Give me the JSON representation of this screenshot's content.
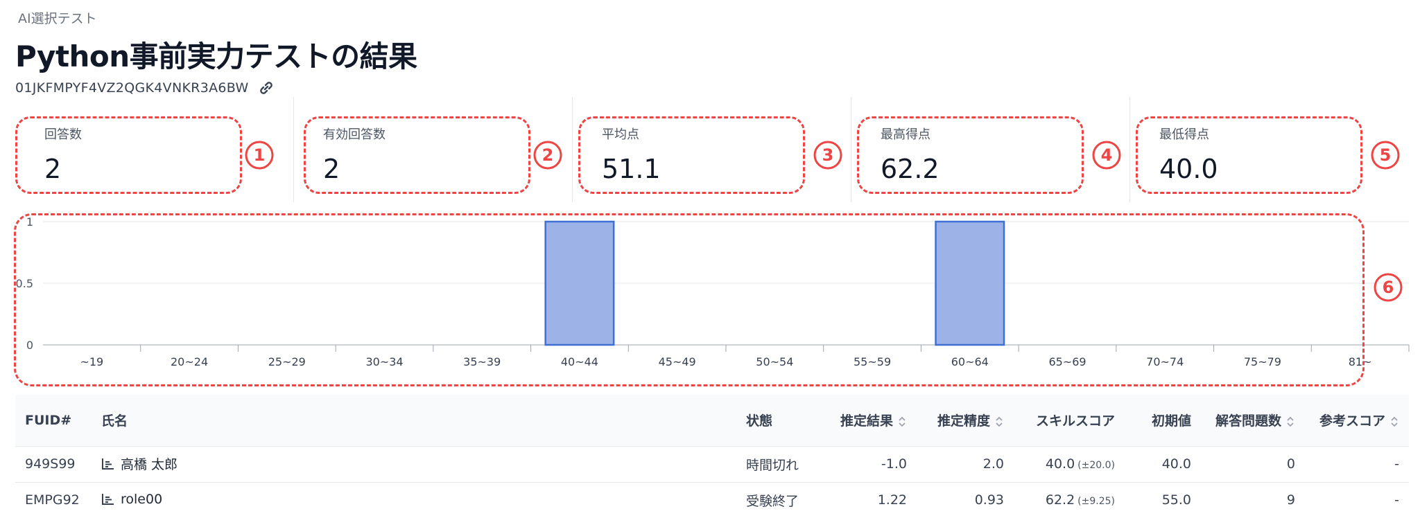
{
  "breadcrumb": "AI選択テスト",
  "title": "Python事前実力テストの結果",
  "test_id": "01JKFMPYF4VZ2QGK4VNKR3A6BW",
  "stats": [
    {
      "label": "回答数",
      "value": "2",
      "badge": "①"
    },
    {
      "label": "有効回答数",
      "value": "2",
      "badge": "②"
    },
    {
      "label": "平均点",
      "value": "51.1",
      "badge": "③"
    },
    {
      "label": "最高得点",
      "value": "62.2",
      "badge": "④"
    },
    {
      "label": "最低得点",
      "value": "40.0",
      "badge": "⑤"
    }
  ],
  "chart_badge": "⑥",
  "chart_data": {
    "type": "bar",
    "categories": [
      "~19",
      "20~24",
      "25~29",
      "30~34",
      "35~39",
      "40~44",
      "45~49",
      "50~54",
      "55~59",
      "60~64",
      "65~69",
      "70~74",
      "75~79",
      "81~"
    ],
    "values": [
      0,
      0,
      0,
      0,
      0,
      1,
      0,
      0,
      0,
      1,
      0,
      0,
      0,
      0
    ],
    "yticks": [
      "0",
      "0.5",
      "1"
    ],
    "ylim": [
      0,
      1
    ],
    "grid": true,
    "bar_color": "#9db3e8",
    "bar_stroke": "#3f6fd1"
  },
  "table": {
    "headers": [
      {
        "label": "FUID#",
        "sortable": false
      },
      {
        "label": "氏名",
        "sortable": false
      },
      {
        "label": "状態",
        "sortable": false
      },
      {
        "label": "推定結果",
        "sortable": true
      },
      {
        "label": "推定精度",
        "sortable": true
      },
      {
        "label": "スキルスコア",
        "sortable": false
      },
      {
        "label": "初期値",
        "sortable": false
      },
      {
        "label": "解答問題数",
        "sortable": true
      },
      {
        "label": "参考スコア",
        "sortable": true
      }
    ],
    "rows": [
      {
        "fuid": "949S99",
        "name": "高橋 太郎",
        "status": "時間切れ",
        "estimate": "-1.0",
        "precision": "2.0",
        "skill": "40.0",
        "skill_err": "(±20.0)",
        "initial": "40.0",
        "answered": "0",
        "ref": "-"
      },
      {
        "fuid": "EMPG92",
        "name": "role00",
        "status": "受験終了",
        "estimate": "1.22",
        "precision": "0.93",
        "skill": "62.2",
        "skill_err": "(±9.25)",
        "initial": "55.0",
        "answered": "9",
        "ref": "-"
      }
    ]
  },
  "colors": {
    "annotation": "#ef4444",
    "status_timeout": "#ef4444"
  }
}
